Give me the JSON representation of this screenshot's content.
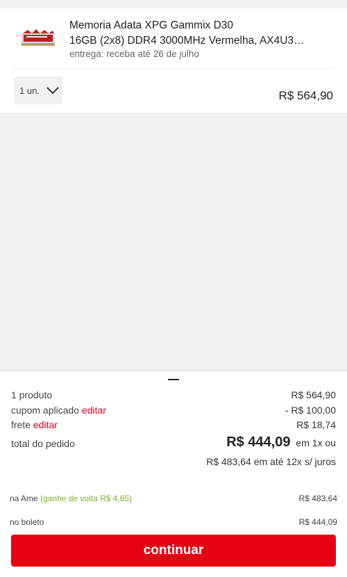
{
  "cart_item": {
    "title_line1": "Memoria Adata XPG Gammix D30",
    "title_line2": "16GB (2x8) DDR4 3000MHz Vermelha, AX4U3…",
    "delivery": "entrega: receba até 26 de julho",
    "quantity": "1 un.",
    "price": "R$ 564,90",
    "image_icon": "ram-module-icon"
  },
  "summary": {
    "products_label": "1 produto",
    "products_value": "R$ 564,90",
    "coupon_label": "cupom aplicado",
    "coupon_edit": "editar",
    "coupon_value": "- R$ 100,00",
    "shipping_label": "frete",
    "shipping_edit": "editar",
    "shipping_value": "R$ 18,74",
    "total_label": "total do pedido",
    "total_value": "R$ 444,09",
    "total_suffix": "em 1x ou",
    "installments": "R$ 483,64 em até 12x s/ juros",
    "ame_label": "na Ame",
    "ame_cashback": "(ganhe de volta R$ 4,65)",
    "ame_value": "R$ 483,64",
    "boleto_label": "no boleto",
    "boleto_value": "R$ 444,09",
    "continue_label": "continuar"
  },
  "colors": {
    "accent_red": "#e60014",
    "edit_red": "#d8001d",
    "green": "#7bb32e"
  }
}
